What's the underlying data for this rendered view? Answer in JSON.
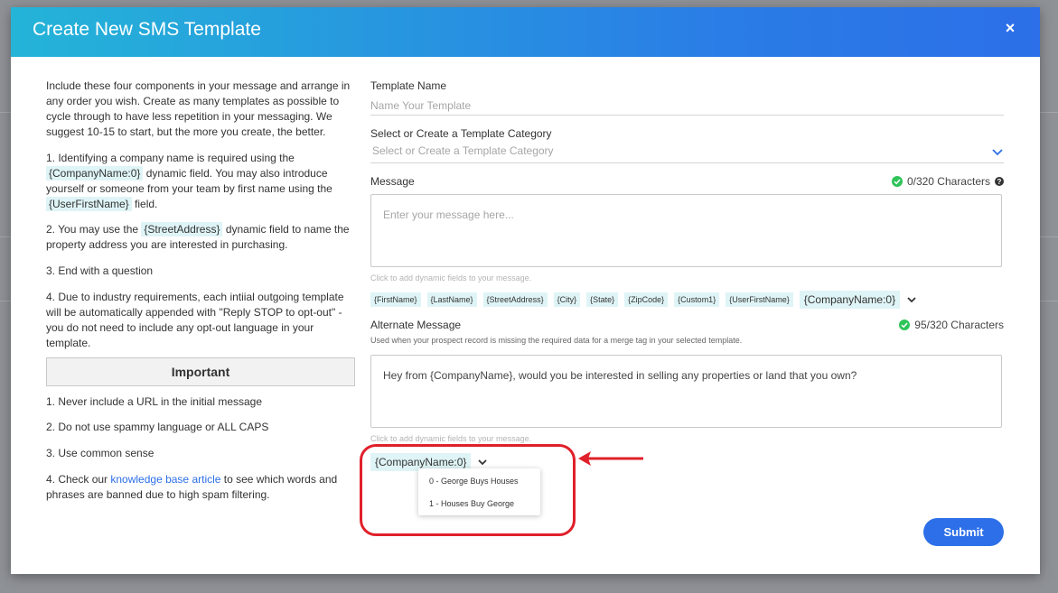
{
  "modal": {
    "title": "Create New SMS Template",
    "close_label": "×"
  },
  "instructions": {
    "intro": "Include these four components in your message and arrange in any order you wish. Create as many templates as possible to cycle through to have less repetition in your messaging. We suggest 10-15 to start, but the more you create, the better.",
    "item1_a": "1. Identifying a company name is required using the ",
    "item1_tag1": "{CompanyName:0}",
    "item1_b": " dynamic field. You may also introduce yourself or someone from your team by first name using the ",
    "item1_tag2": "{UserFirstName}",
    "item1_c": " field.",
    "item2_a": "2. You may use the ",
    "item2_tag": "{StreetAddress}",
    "item2_b": " dynamic field to name the property address you are interested in purchasing.",
    "item3": "3. End with a question",
    "item4": "4. Due to industry requirements, each intiial outgoing template will be automatically appended with \"Reply STOP to opt-out\" - you do not need to include any opt-out language in your template.",
    "important_heading": "Important",
    "rule1": "1. Never include a URL in the initial message",
    "rule2": "2. Do not use spammy language or ALL CAPS",
    "rule3": "3. Use common sense",
    "rule4_a": "4. Check our ",
    "rule4_link": "knowledge base article",
    "rule4_b": " to see which words and phrases are banned due to high spam filtering."
  },
  "form": {
    "template_name_label": "Template Name",
    "template_name_placeholder": "Name Your Template",
    "category_label": "Select or Create a Template Category",
    "category_placeholder": "Select or Create a Template Category",
    "message_label": "Message",
    "message_counter": "0/320 Characters",
    "message_placeholder": "Enter your message here...",
    "dynamic_hint": "Click to add dynamic fields to your message.",
    "dynamic_fields": [
      "{FirstName}",
      "{LastName}",
      "{StreetAddress}",
      "{City}",
      "{State}",
      "{ZipCode}",
      "{Custom1}",
      "{UserFirstName}"
    ],
    "company_field": "{CompanyName:0}",
    "alt_label": "Alternate Message",
    "alt_counter": "95/320 Characters",
    "alt_note": "Used when your prospect record is missing the required data for a merge tag in your selected template.",
    "alt_value": "Hey from {CompanyName}, would you be interested in selling any properties or land that you own?",
    "alt_dynamic_hint": "Click to add dynamic fields to your message.",
    "alt_company_field": "{CompanyName:0}",
    "company_options": [
      "0 - George Buys Houses",
      "1 - Houses Buy George"
    ],
    "submit_label": "Submit"
  },
  "colors": {
    "header_start": "#24b4d8",
    "header_end": "#2c6fe8",
    "accent": "#2c6fe8",
    "success": "#2ec45a",
    "tag_bg": "#dff4f6",
    "highlight": "#e0202a"
  }
}
